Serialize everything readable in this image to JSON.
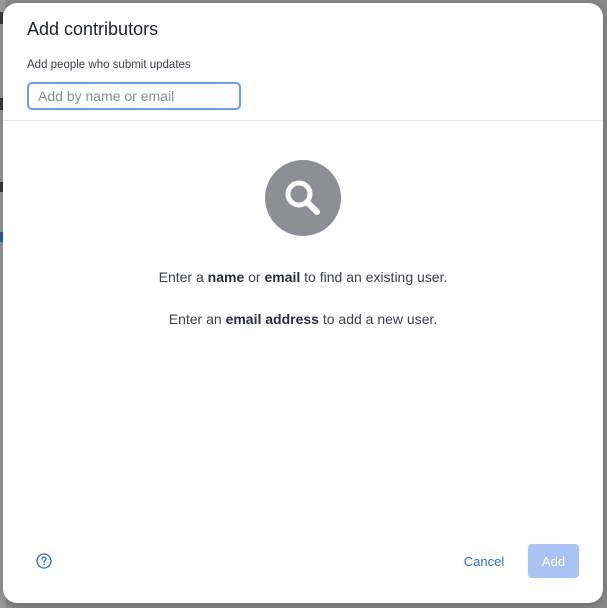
{
  "dialog": {
    "title": "Add contributors",
    "subtitle": "Add people who submit updates",
    "search": {
      "placeholder": "Add by name or email",
      "value": ""
    },
    "empty_state": {
      "icon": "search-icon",
      "line1": {
        "part1": "Enter a ",
        "bold1": "name",
        "part2": " or ",
        "bold2": "email",
        "part3": " to find an existing user."
      },
      "line2": {
        "part1": "Enter an ",
        "bold1": "email address",
        "part2": " to add a new user."
      }
    },
    "footer": {
      "help_icon": "question-circle-icon",
      "cancel_label": "Cancel",
      "add_label": "Add"
    }
  },
  "colors": {
    "accent": "#2f6fd0",
    "add_disabled": "#a9c4f2",
    "input_focus_border": "#6f9ce6",
    "icon_circle": "#8e8f94"
  }
}
